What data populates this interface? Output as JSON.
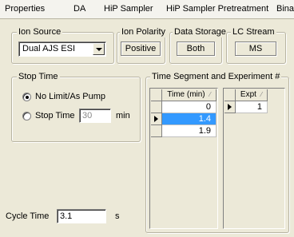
{
  "tabs": [
    "Properties",
    "DA",
    "HiP Sampler",
    "HiP Sampler Pretreatment",
    "Bina"
  ],
  "ion_source": {
    "label": "Ion Source",
    "value": "Dual AJS ESI"
  },
  "ion_polarity": {
    "label": "Ion Polarity",
    "value": "Positive"
  },
  "data_storage": {
    "label": "Data Storage",
    "value": "Both"
  },
  "lc_stream": {
    "label": "LC Stream",
    "value": "MS"
  },
  "stop_time": {
    "label": "Stop Time",
    "option_no_limit": "No Limit/As Pump",
    "option_stop_time": "Stop Time",
    "value": "30",
    "unit": "min",
    "selected": "no_limit"
  },
  "time_segment": {
    "label": "Time Segment and Experiment #",
    "time_header": "Time (min)",
    "time_values": [
      "0",
      "1.4",
      "1.9"
    ],
    "selected_row": 1,
    "expt_header": "Expt",
    "expt_values": [
      "1"
    ]
  },
  "cycle_time": {
    "label": "Cycle Time",
    "value": "3.1",
    "unit": "s"
  },
  "colors": {
    "selection": "#3399ff",
    "background": "#ece9d8"
  }
}
